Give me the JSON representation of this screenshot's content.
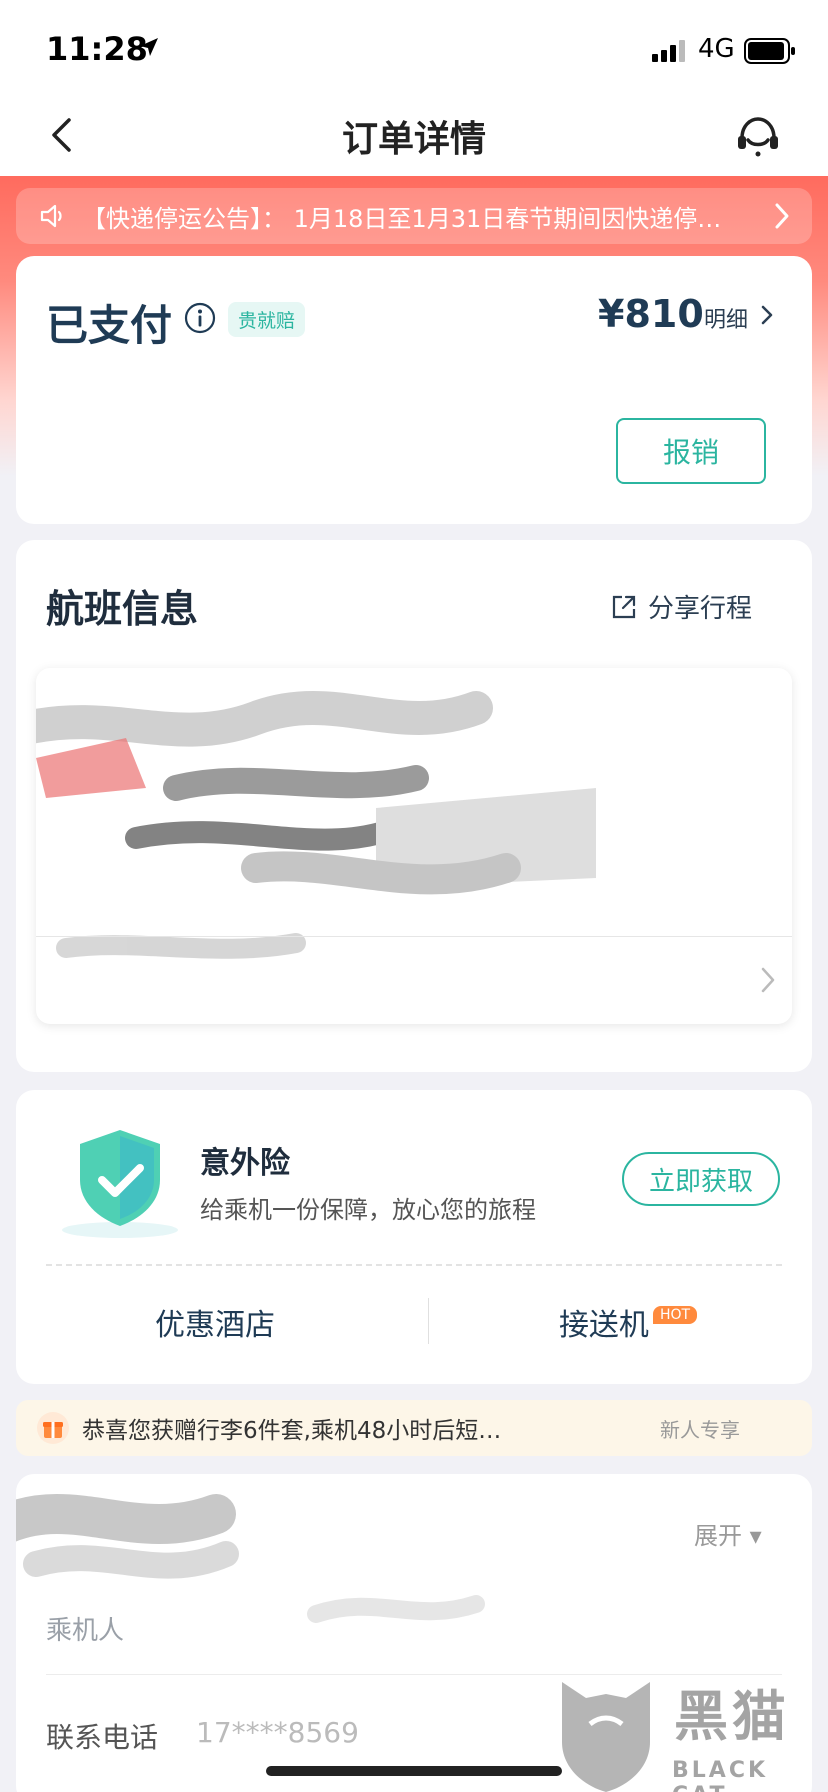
{
  "status_bar": {
    "time": "11:28",
    "network": "4G"
  },
  "nav": {
    "title": "订单详情"
  },
  "notice": {
    "text": "【快递停运公告】： 1月18日至1月31日春节期间因快递停…"
  },
  "payment": {
    "status": "已支付",
    "badge": "贵就赔",
    "amount": "¥810",
    "detail_label": "明细",
    "reimburse_label": "报销"
  },
  "flight": {
    "title": "航班信息",
    "share_label": "分享行程"
  },
  "insurance": {
    "title": "意外险",
    "subtitle": "给乘机一份保障，放心您的旅程",
    "cta_label": "立即获取"
  },
  "services": {
    "hotel_label": "优惠酒店",
    "transfer_label": "接送机",
    "hot_badge": "HOT"
  },
  "promo": {
    "text": "恭喜您获赠行李6件套,乘机48小时后短…",
    "tag": "新人专享"
  },
  "passenger": {
    "expand_label": "展开",
    "passenger_label": "乘机人",
    "contact_label": "联系电话",
    "contact_phone": "17****8569"
  },
  "watermark": {
    "text": "黑猫",
    "sub": "BLACK CAT"
  },
  "colors": {
    "accent_teal": "#2bb5a0",
    "header_red": "#ff6b5e",
    "text_dark": "#1f3b55"
  }
}
